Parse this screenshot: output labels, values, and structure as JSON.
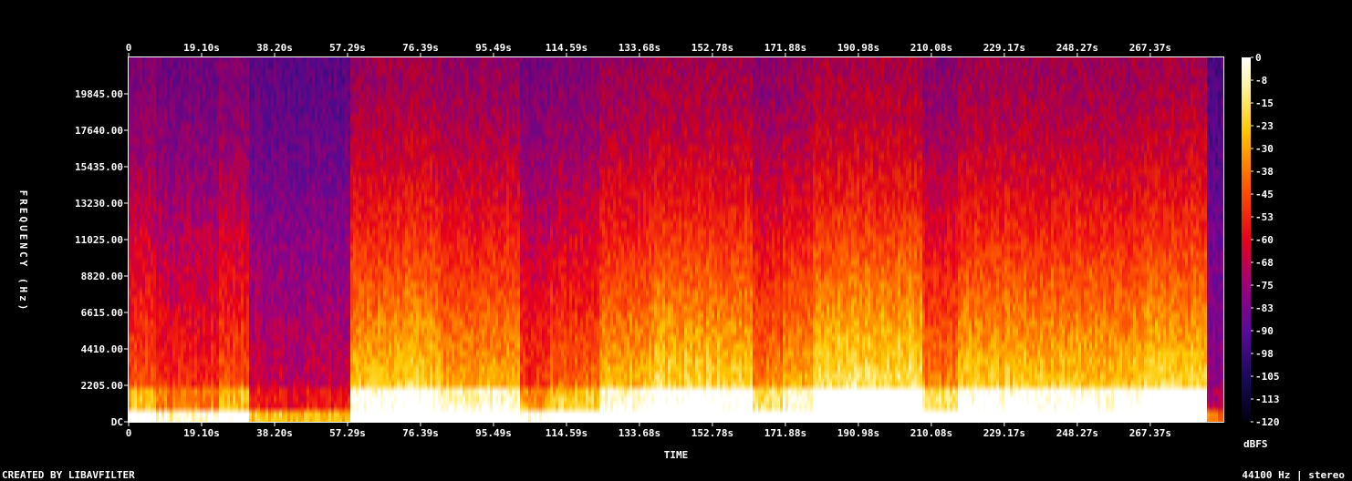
{
  "chart_data": {
    "type": "heatmap",
    "title": "",
    "xlabel": "TIME",
    "ylabel": "FREQUENCY (Hz)",
    "x_ticks": [
      "0",
      "19.10s",
      "38.20s",
      "57.29s",
      "76.39s",
      "95.49s",
      "114.59s",
      "133.68s",
      "152.78s",
      "171.88s",
      "190.98s",
      "210.08s",
      "229.17s",
      "248.27s",
      "267.37s"
    ],
    "x_tick_values": [
      0,
      19.1,
      38.2,
      57.29,
      76.39,
      95.49,
      114.59,
      133.68,
      152.78,
      171.88,
      190.98,
      210.08,
      229.17,
      248.27,
      267.37
    ],
    "xlim": [
      0,
      286.5
    ],
    "y_ticks": [
      "DC",
      "2205.00",
      "4410.00",
      "6615.00",
      "8820.00",
      "11025.00",
      "13230.00",
      "15435.00",
      "17640.00",
      "19845.00"
    ],
    "y_tick_values": [
      0,
      2205,
      4410,
      6615,
      8820,
      11025,
      13230,
      15435,
      17640,
      19845
    ],
    "ylim": [
      0,
      22050
    ],
    "colorbar": {
      "label": "dBFS",
      "ticks": [
        "0",
        "-8",
        "-15",
        "-23",
        "-30",
        "-38",
        "-45",
        "-53",
        "-60",
        "-68",
        "-75",
        "-83",
        "-90",
        "-98",
        "-105",
        "-113",
        "-120"
      ],
      "range": [
        -120,
        0
      ]
    },
    "grid": false,
    "colormap": "fire",
    "segments": [
      {
        "start": 0,
        "end": 7,
        "level": 0.62
      },
      {
        "start": 7,
        "end": 23,
        "level": 0.52
      },
      {
        "start": 23,
        "end": 31,
        "level": 0.62
      },
      {
        "start": 31,
        "end": 36,
        "level": 0.38
      },
      {
        "start": 36,
        "end": 58,
        "level": 0.35
      },
      {
        "start": 58,
        "end": 70,
        "level": 0.85
      },
      {
        "start": 70,
        "end": 81,
        "level": 0.88
      },
      {
        "start": 81,
        "end": 95,
        "level": 0.78
      },
      {
        "start": 95,
        "end": 102,
        "level": 0.8
      },
      {
        "start": 102,
        "end": 110,
        "level": 0.55
      },
      {
        "start": 110,
        "end": 123,
        "level": 0.65
      },
      {
        "start": 123,
        "end": 136,
        "level": 0.82
      },
      {
        "start": 136,
        "end": 163,
        "level": 0.88
      },
      {
        "start": 163,
        "end": 171,
        "level": 0.7
      },
      {
        "start": 171,
        "end": 179,
        "level": 0.8
      },
      {
        "start": 179,
        "end": 207,
        "level": 0.93
      },
      {
        "start": 207,
        "end": 217,
        "level": 0.7
      },
      {
        "start": 217,
        "end": 266,
        "level": 0.85
      },
      {
        "start": 266,
        "end": 282,
        "level": 0.9
      },
      {
        "start": 282,
        "end": 286.5,
        "level": 0.25
      }
    ]
  },
  "footer": {
    "left": "CREATED BY LIBAVFILTER",
    "right": "44100 Hz | stereo"
  },
  "colors": {
    "background": "#000000",
    "text": "#ffffff"
  }
}
